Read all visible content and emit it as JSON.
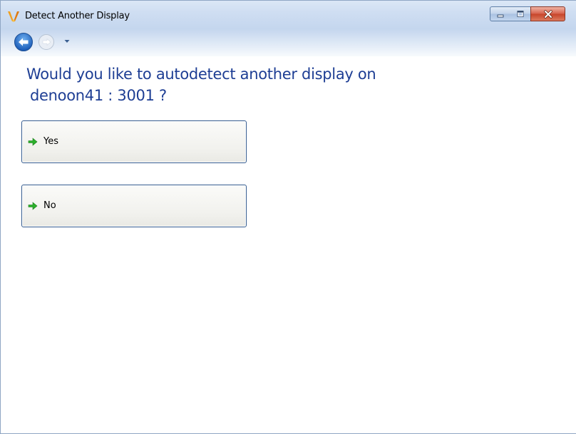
{
  "window": {
    "title": "Detect Another Display"
  },
  "caption_buttons": {
    "minimize_icon": "minimize-icon",
    "maximize_icon": "maximize-icon",
    "close_icon": "close-icon"
  },
  "nav": {
    "back_icon": "back-arrow-icon",
    "forward_icon": "forward-arrow-icon",
    "dropdown_icon": "chevron-down-icon"
  },
  "main": {
    "question_line1": "Would you like to autodetect another display on",
    "question_line2": "denoon41 : 3001 ?",
    "options": [
      {
        "label": "Yes",
        "icon": "green-arrow-icon"
      },
      {
        "label": "No",
        "icon": "green-arrow-icon"
      }
    ]
  },
  "colors": {
    "question_text": "#1e3e94",
    "option_border": "#355c8f",
    "arrow_green": "#2bb02b"
  }
}
